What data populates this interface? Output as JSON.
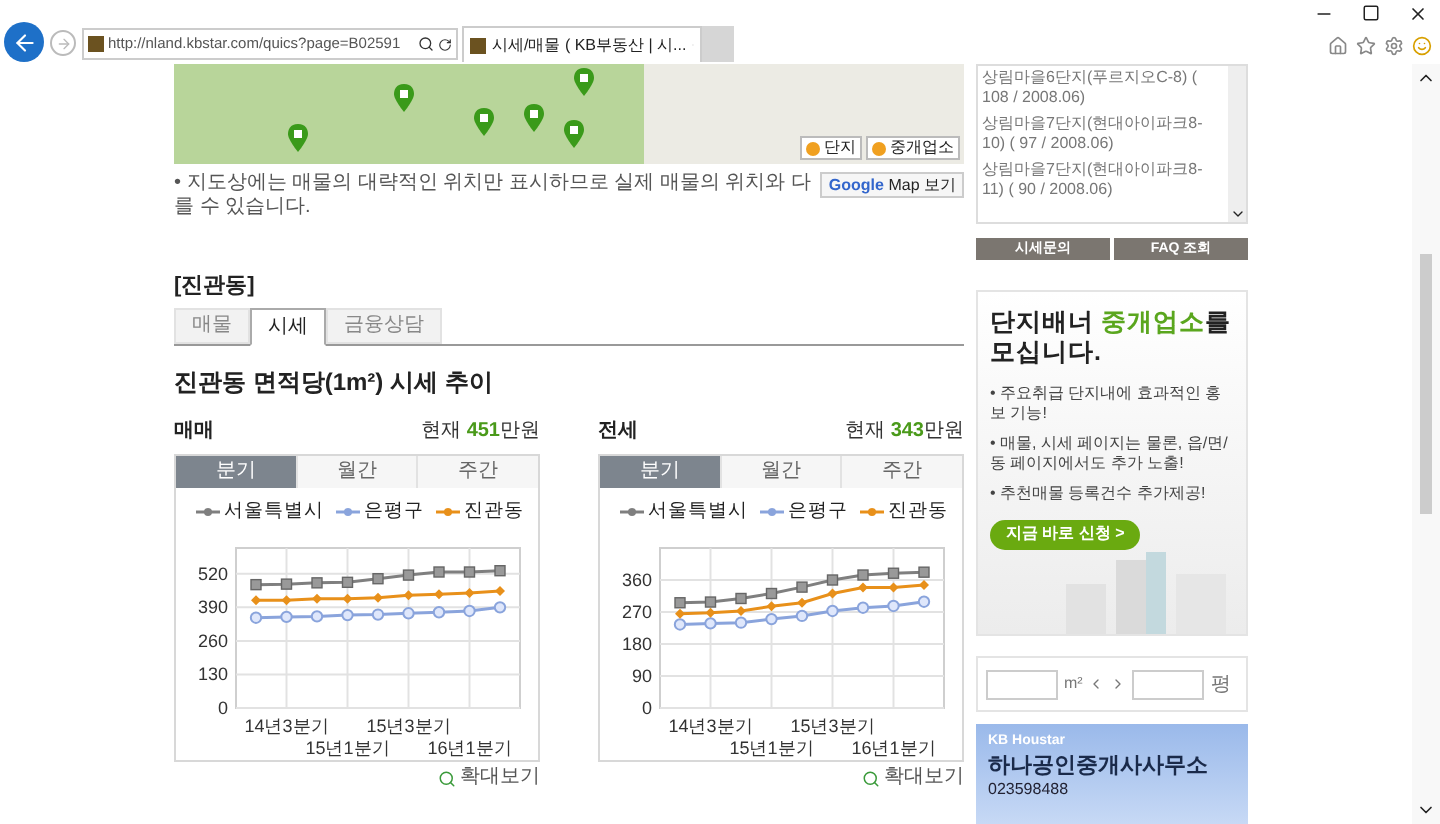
{
  "browser": {
    "address": "http://nland.kbstar.com/quics?page=B02591",
    "tabs": [
      {
        "label": "시세/매물 ( KB부동산 | 시...",
        "selected": true
      }
    ]
  },
  "map": {
    "legend": [
      {
        "label": "단지",
        "color": "#f0a020"
      },
      {
        "label": "중개업소",
        "color": "#f0a020"
      }
    ],
    "notice": "• 지도상에는 매물의 대략적인 위치만 표시하므로 실제 매물의 위치와 다를 수 있습니다.",
    "google_button": {
      "logo": "Google",
      "label": "Map 보기"
    }
  },
  "section_title": "[진관동]",
  "tabs": [
    {
      "label": "매물",
      "selected": false
    },
    {
      "label": "시세",
      "selected": true
    },
    {
      "label": "금융상담",
      "selected": false
    }
  ],
  "trend_title": "진관동 면적당(1m²) 시세 추이",
  "charts": [
    {
      "label": "매매",
      "current_prefix": "현재",
      "current_value": "451",
      "current_unit": "만원",
      "zoom_link": "확대보기",
      "period_tabs": [
        {
          "label": "분기",
          "selected": true
        },
        {
          "label": "월간",
          "selected": false
        },
        {
          "label": "주간",
          "selected": false
        }
      ],
      "chart_data": {
        "type": "line",
        "categories": [
          null,
          "14년3분기",
          null,
          "15년1분기",
          null,
          "15년3분기",
          null,
          "16년1분기",
          null
        ],
        "ylim": [
          0,
          620
        ],
        "yticks": [
          0,
          130,
          260,
          390,
          520
        ],
        "grid": true,
        "series": [
          {
            "name": "서울특별시",
            "color": "#7f7f7f",
            "marker": "square",
            "values": [
              478,
              480,
              485,
              487,
              501,
              515,
              527,
              527,
              532
            ]
          },
          {
            "name": "은평구",
            "color": "#8aa4dc",
            "marker": "circle",
            "values": [
              350,
              353,
              355,
              360,
              362,
              367,
              371,
              376,
              390
            ]
          },
          {
            "name": "진관동",
            "color": "#e8901a",
            "marker": "diamond",
            "values": [
              418,
              418,
              423,
              423,
              427,
              437,
              441,
              446,
              453
            ]
          }
        ]
      }
    },
    {
      "label": "전세",
      "current_prefix": "현재",
      "current_value": "343",
      "current_unit": "만원",
      "zoom_link": "확대보기",
      "period_tabs": [
        {
          "label": "분기",
          "selected": true
        },
        {
          "label": "월간",
          "selected": false
        },
        {
          "label": "주간",
          "selected": false
        }
      ],
      "chart_data": {
        "type": "line",
        "categories": [
          null,
          "14년3분기",
          null,
          "15년1분기",
          null,
          "15년3분기",
          null,
          "16년1분기",
          null
        ],
        "ylim": [
          0,
          450
        ],
        "yticks": [
          0,
          90,
          180,
          270,
          360
        ],
        "grid": true,
        "series": [
          {
            "name": "서울특별시",
            "color": "#7f7f7f",
            "marker": "square",
            "values": [
              296,
              298,
              308,
              322,
              340,
              360,
              374,
              379,
              382
            ]
          },
          {
            "name": "은평구",
            "color": "#8aa4dc",
            "marker": "circle",
            "values": [
              235,
              238,
              240,
              250,
              259,
              273,
              282,
              287,
              299
            ]
          },
          {
            "name": "진관동",
            "color": "#e8901a",
            "marker": "diamond",
            "values": [
              265,
              268,
              273,
              286,
              296,
              322,
              339,
              339,
              346
            ]
          }
        ]
      }
    }
  ],
  "sidebar": {
    "apartments": [
      "상림마을6단지(푸르지오C-8) ( 108 / 2008.06)",
      "상림마을7단지(현대아이파크8-10) ( 97 / 2008.06)",
      "상림마을7단지(현대아이파크8-11) ( 90 / 2008.06)"
    ],
    "buttons": [
      "시세문의",
      "FAQ 조회"
    ],
    "banner": {
      "title_before": "단지배너 ",
      "title_highlight": "중개업소",
      "title_after": "를 모십니다.",
      "bullets": [
        "• 주요취급 단지내에 효과적인 홍보 기능!",
        "• 매물, 시세 페이지는 물론, 읍/면/동 페이지에서도 추가 노출!",
        "• 추천매물 등록건수 추가제공!"
      ],
      "cta": "지금 바로 신청 >"
    },
    "converter": {
      "unit_area": "m²",
      "unit_pyeong": "평"
    },
    "ad": {
      "brand": "KB Houstar",
      "name": "하나공인중개사사무소",
      "phone": "023598488"
    }
  }
}
